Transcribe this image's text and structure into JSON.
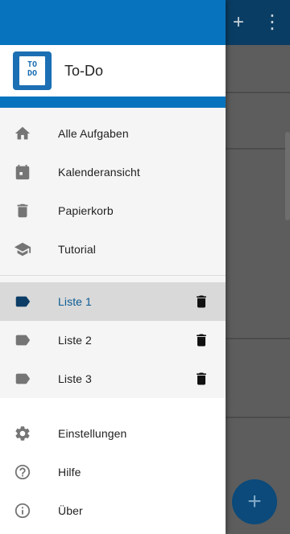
{
  "app": {
    "title": "To-Do",
    "logo_text": "TO DO"
  },
  "colors": {
    "primary": "#0773be",
    "primary_dark": "#0a3d63",
    "selected_text": "#0c5b95"
  },
  "background": {
    "add_icon": "+",
    "more_icon": "⋮",
    "fab_icon": "+"
  },
  "nav_main": [
    {
      "label": "Alle Aufgaben",
      "icon": "home-icon"
    },
    {
      "label": "Kalenderansicht",
      "icon": "calendar-icon"
    },
    {
      "label": "Papierkorb",
      "icon": "trash-icon"
    },
    {
      "label": "Tutorial",
      "icon": "school-icon"
    }
  ],
  "lists": [
    {
      "label": "Liste 1",
      "icon": "label-icon",
      "selected": true
    },
    {
      "label": "Liste 2",
      "icon": "label-icon",
      "selected": false
    },
    {
      "label": "Liste 3",
      "icon": "label-icon",
      "selected": false
    }
  ],
  "nav_bottom": [
    {
      "label": "Einstellungen",
      "icon": "settings-icon"
    },
    {
      "label": "Hilfe",
      "icon": "help-icon"
    },
    {
      "label": "Über",
      "icon": "info-icon"
    }
  ]
}
